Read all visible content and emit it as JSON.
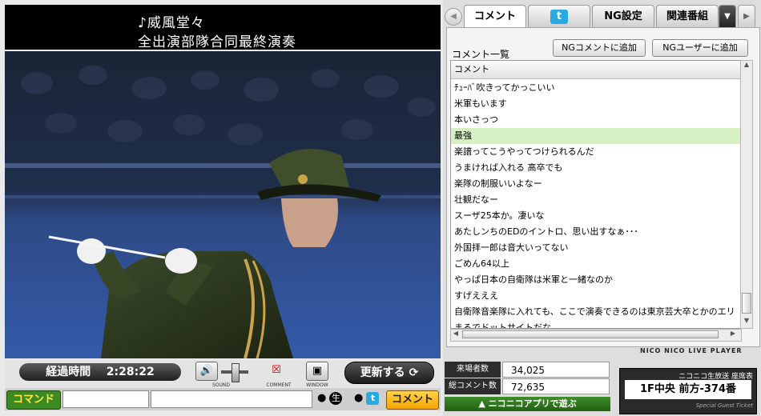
{
  "player": {
    "title_line1": "♪威風堂々",
    "title_line2": "全出演部隊合同最終演奏",
    "elapsed_label": "経過時間",
    "elapsed_time": "2:28:22",
    "sound_label": "SOUND",
    "comment_label": "COMMENT",
    "window_label": "WINDOW",
    "refresh_label": "更新する",
    "command_button": "コマンド",
    "live_radio": "生",
    "comment_submit": "コメント"
  },
  "tabs": [
    "コメント",
    "",
    "NG設定",
    "関連番組"
  ],
  "comments_panel": {
    "list_label": "コメント一覧",
    "ng_comment_button": "NGコメントに追加",
    "ng_user_button": "NGユーザーに追加",
    "column_header": "コメント",
    "rows": [
      "ﾁｭｰﾊﾞ吹きってかっこいい",
      "米軍もいます",
      "本いさっつ",
      "最強",
      "楽譜ってこうやってつけられるんだ",
      "うまければ入れる 高卒でも",
      "楽隊の制服いいよなー",
      "壮観だなー",
      "スーザ25本か。凄いな",
      "あたしンちのEDのイントロ、思い出すなぁ･･･",
      "外国拝一郎は音大いってない",
      "ごめん64以上",
      "やっぱ日本の自衛隊は米軍と一緒なのか",
      "すげえええ",
      "自衛隊音楽隊に入れても、ここで演奏できるのは東京芸大卒とかのエリ",
      "まるでドットサイトだな"
    ],
    "highlight_row": 3,
    "brand": "NICO NICO LIVE PLAYER"
  },
  "stats": {
    "visitors_label": "来場者数",
    "visitors_value": "34,025",
    "comments_label": "総コメント数",
    "comments_value": "72,635",
    "app_label": "ニコニコアプリで遊ぶ"
  },
  "ticket": {
    "title": "ニコニコ生放送 座席表",
    "seat": "1F中央 前方-374番",
    "footer": "Special Guest Ticket"
  },
  "colors": {
    "highlight": "#d6f0c4",
    "accent_green": "#3d8a22",
    "accent_yellow": "#f5a400",
    "twitter_blue": "#29a9e1"
  }
}
